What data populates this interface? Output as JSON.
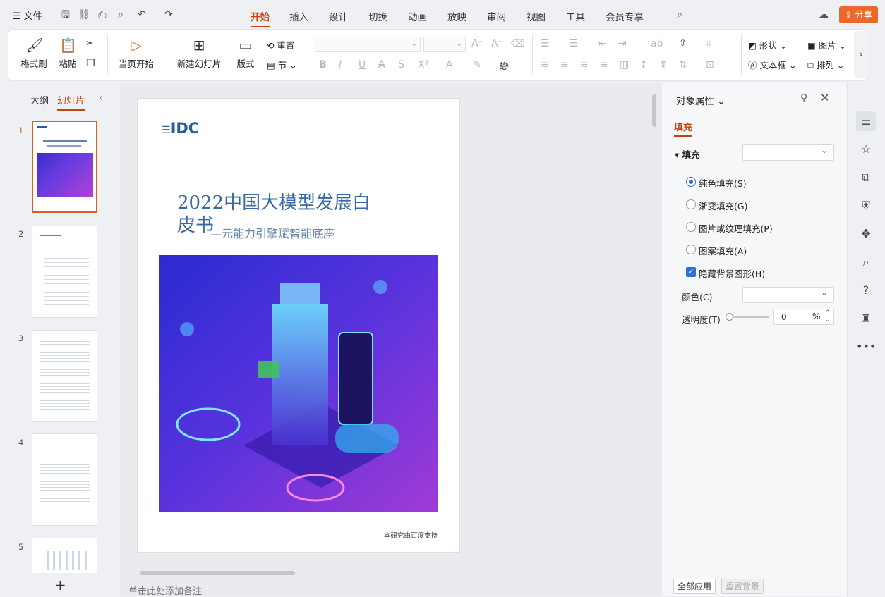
{
  "menu": {
    "file": "文件",
    "tabs": [
      "开始",
      "插入",
      "设计",
      "切换",
      "动画",
      "放映",
      "审阅",
      "视图",
      "工具",
      "会员专享"
    ],
    "active_tab": "开始",
    "share": "分享"
  },
  "ribbon": {
    "format_brush": "格式刷",
    "paste": "粘贴",
    "start_current": "当页开始",
    "new_slide": "新建幻灯片",
    "layout": "版式",
    "reset": "重置",
    "section": "节",
    "shape": "形状",
    "picture": "图片",
    "textbox": "文本框",
    "arrange": "排列"
  },
  "left_pane": {
    "tab_outline": "大纲",
    "tab_slides": "幻灯片",
    "slides": [
      "1",
      "2",
      "3",
      "4",
      "5"
    ],
    "add": "+"
  },
  "slide": {
    "logo": "IDC",
    "title": "2022中国大模型发展白皮书",
    "subtitle": "—元能力引擎赋智能底座",
    "footer": "本研究由百度支持"
  },
  "notes_placeholder": "单击此处添加备注",
  "properties": {
    "title": "对象属性",
    "section_tab": "填充",
    "fill_group": "填充",
    "options": [
      "纯色填充(S)",
      "渐变填充(G)",
      "图片或纹理填充(P)",
      "图案填充(A)"
    ],
    "selected_option": "纯色填充(S)",
    "hide_bg_graphics": "隐藏背景图形(H)",
    "color_label": "颜色(C)",
    "transparency_label": "透明度(T)",
    "transparency_value": "0",
    "transparency_unit": "%",
    "apply_all": "全部应用",
    "reset_bg": "重置背景"
  },
  "colors": {
    "accent": "#c5450e",
    "share": "#e9692c",
    "selection": "#d5612a",
    "check": "#2f6fd6"
  }
}
